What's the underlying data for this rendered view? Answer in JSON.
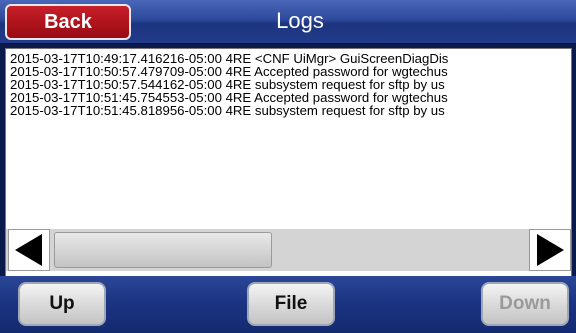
{
  "header": {
    "back_label": "Back",
    "title": "Logs"
  },
  "log": {
    "lines": [
      "2015-03-17T10:49:17.416216-05:00 4RE <CNF UiMgr> GuiScreenDiagDis",
      "2015-03-17T10:50:57.479709-05:00 4RE Accepted password for wgtechus",
      "2015-03-17T10:50:57.544162-05:00 4RE subsystem request for sftp by us",
      "2015-03-17T10:51:45.754553-05:00 4RE Accepted password for wgtechus",
      "2015-03-17T10:51:45.818956-05:00 4RE subsystem request for sftp by us"
    ]
  },
  "scrollbar": {
    "left_icon": "triangle-left-icon",
    "right_icon": "triangle-right-icon"
  },
  "footer": {
    "up_label": "Up",
    "file_label": "File",
    "down_label": "Down",
    "down_state": "disabled"
  },
  "colors": {
    "title_bar": "#2e4a9c",
    "back_button": "#b0141d",
    "bottom_bar": "#1b3381",
    "disabled_text": "#9a9a9a"
  }
}
